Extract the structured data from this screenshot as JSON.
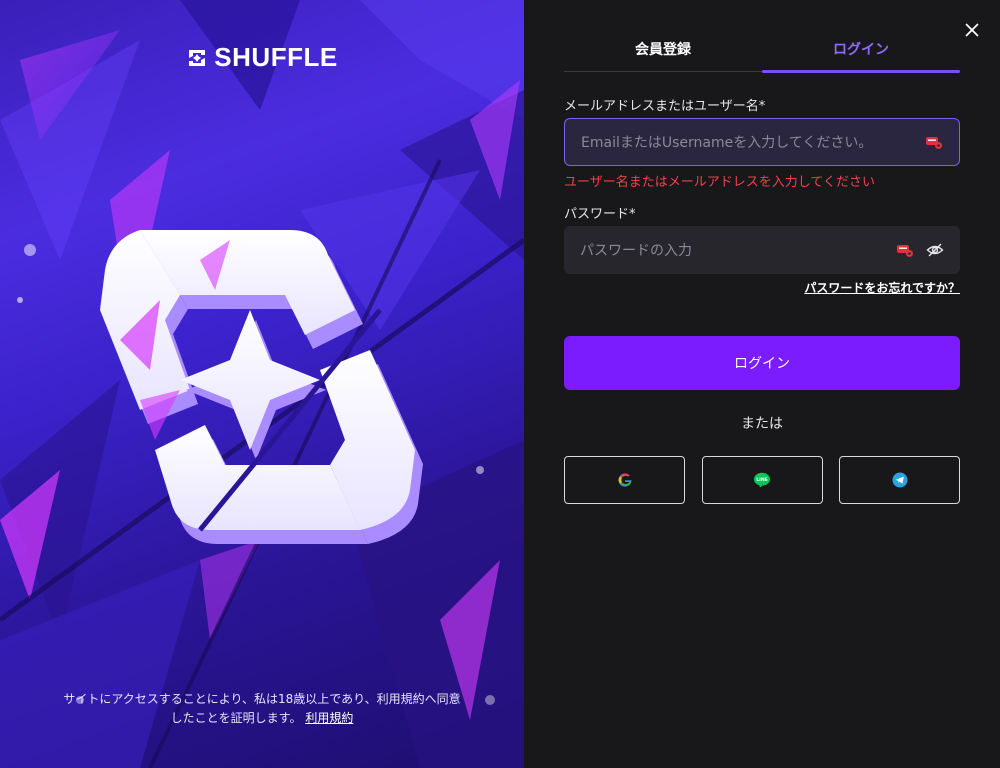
{
  "brand": {
    "name": "SHUFFLE"
  },
  "terms": {
    "line1": "サイトにアクセスすることにより、私は18歳以上であり、利用規約へ同意",
    "line2": "したことを証明します。",
    "link": "利用規約"
  },
  "tabs": [
    {
      "label": "会員登録",
      "active": false
    },
    {
      "label": "ログイン",
      "active": true
    }
  ],
  "username": {
    "label": "メールアドレスまたはユーザー名*",
    "placeholder": "EmailまたはUsernameを入力してください。",
    "error": "ユーザー名またはメールアドレスを入力してください"
  },
  "password": {
    "label": "パスワード*",
    "placeholder": "パスワードの入力",
    "forgot": "パスワードをお忘れですか？"
  },
  "login_button": "ログイン",
  "or_text": "または",
  "social_buttons": [
    "google-icon",
    "line-icon",
    "telegram-icon"
  ],
  "colors": {
    "accent": "#7b1cff",
    "active_tab": "#8f6bff",
    "error": "#f0414b",
    "panel_bg": "#18181b"
  },
  "icons": [
    "close-icon",
    "autofill-key-icon",
    "eye-off-icon"
  ]
}
